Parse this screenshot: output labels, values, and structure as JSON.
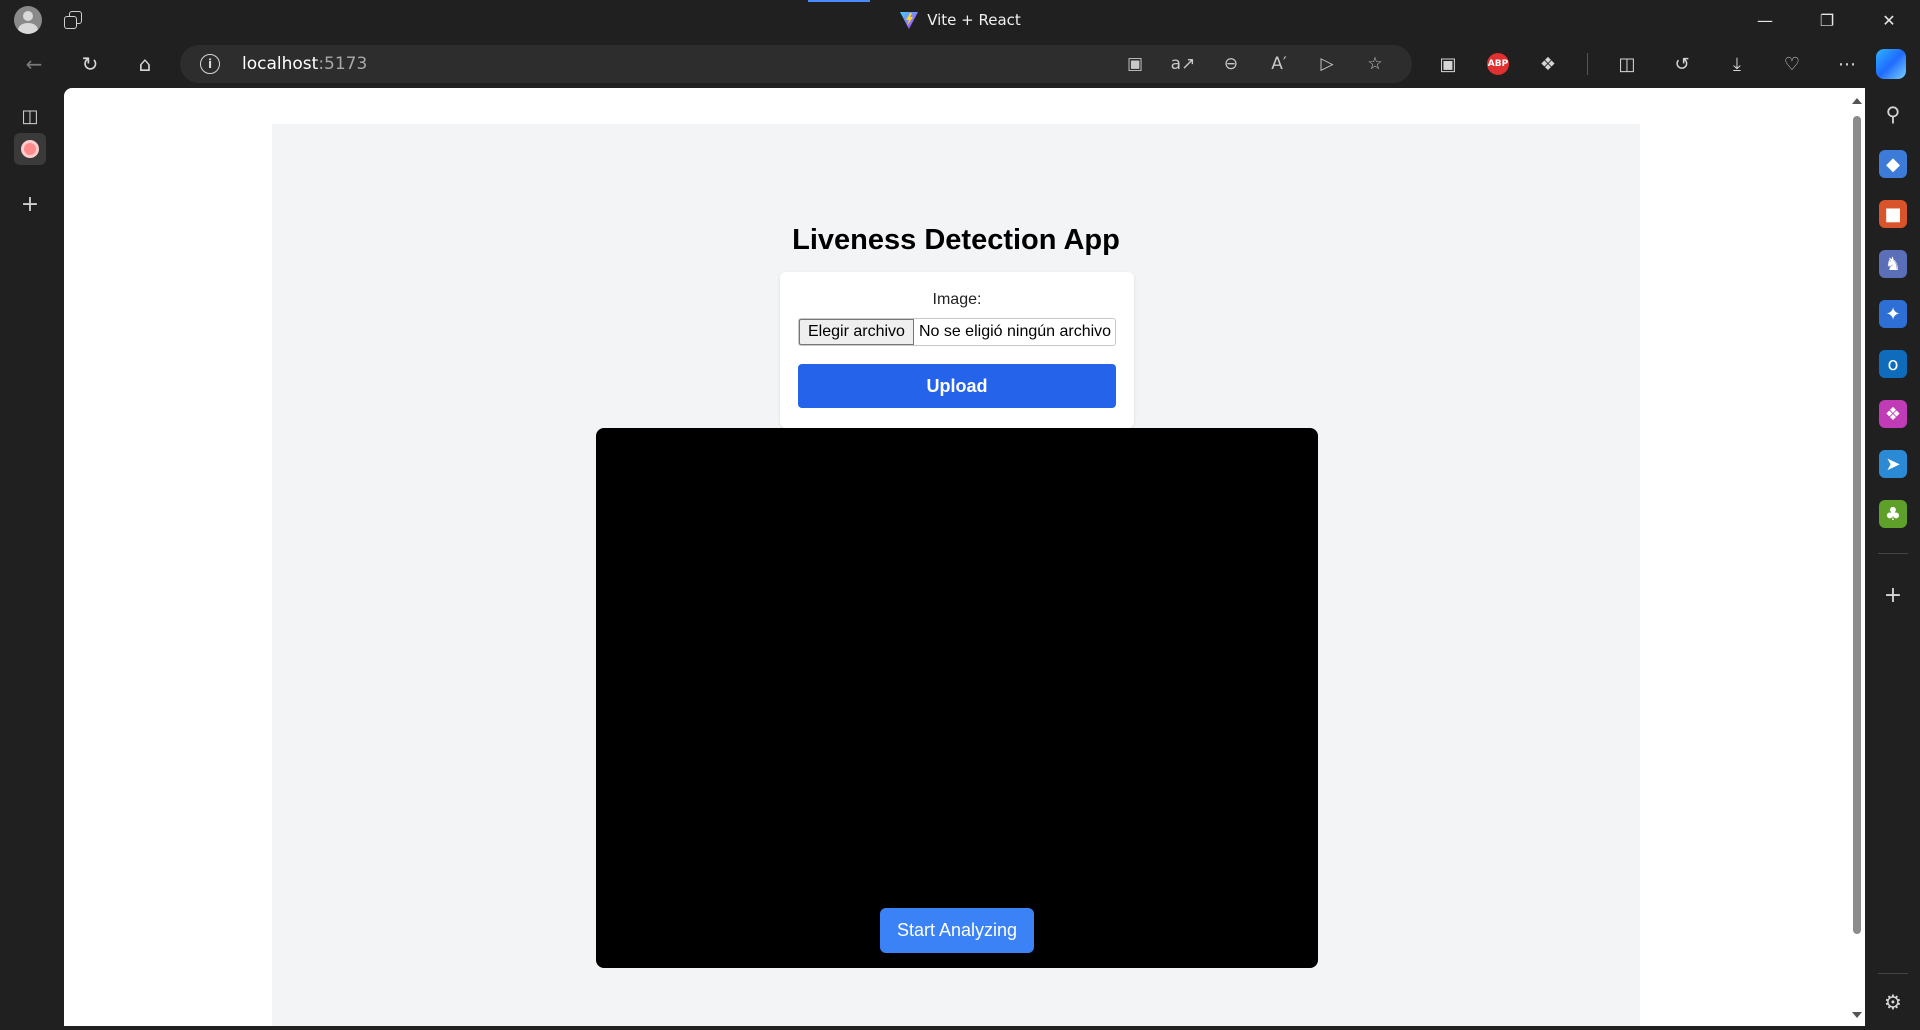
{
  "window": {
    "title": "Vite + React"
  },
  "addressbar": {
    "host": "localhost",
    "port": ":5173"
  },
  "app": {
    "title": "Liveness Detection App",
    "image_label": "Image:",
    "file_button": "Elegir archivo",
    "file_status": "No se eligió ningún archivo",
    "upload_label": "Upload",
    "analyze_label": "Start Analyzing"
  },
  "colors": {
    "upload_button": "#2563eb",
    "analyze_button": "#3b82f6",
    "page_background": "#f3f4f6",
    "video_background": "#000000"
  },
  "toolbar_icons": [
    "camera-icon",
    "translate-icon",
    "zoom-out-icon",
    "read-aloud-icon",
    "screenshot-icon",
    "favorite-star-icon",
    "app-window-icon",
    "adblock-icon",
    "extensions-icon",
    "split-screen-icon",
    "history-icon",
    "downloads-icon",
    "performance-icon",
    "more-icon",
    "copilot-icon"
  ],
  "sidebar_icons": [
    "search-icon",
    "tag-icon",
    "tools-icon",
    "games-icon",
    "copilot-app-icon",
    "outlook-icon",
    "designer-icon",
    "send-icon",
    "tree-icon",
    "add-icon",
    "settings-icon"
  ]
}
